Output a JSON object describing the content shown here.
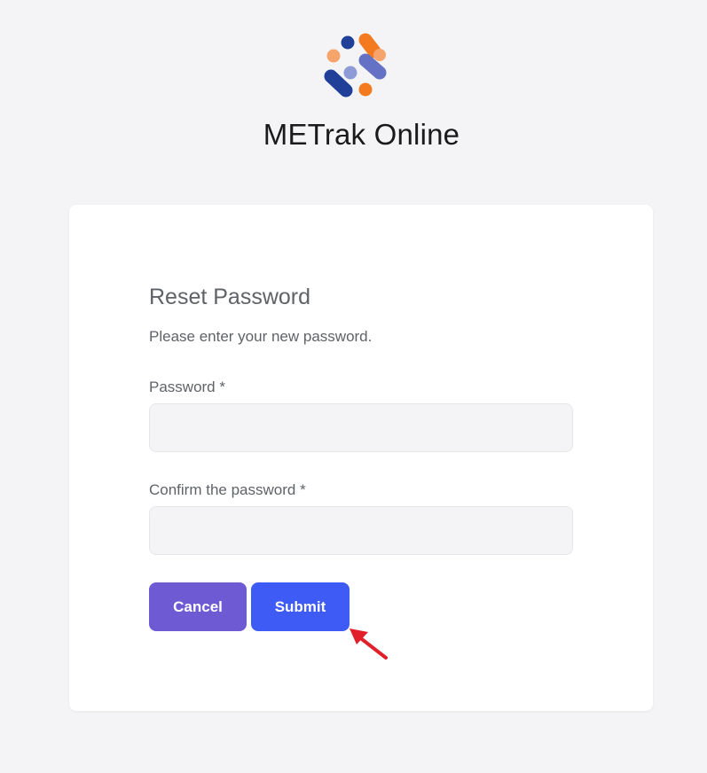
{
  "app": {
    "title": "METrak Online",
    "logo_icon": "dot-network-logo"
  },
  "form": {
    "title": "Reset Password",
    "subtitle": "Please enter your new password.",
    "password": {
      "label": "Password *",
      "value": "",
      "placeholder": ""
    },
    "confirm_password": {
      "label": "Confirm the password *",
      "value": "",
      "placeholder": ""
    },
    "cancel_label": "Cancel",
    "submit_label": "Submit"
  },
  "colors": {
    "page_background": "#f4f4f6",
    "card_background": "#ffffff",
    "cancel_button": "#6e5bd4",
    "submit_button": "#3f5bf6",
    "logo_navy": "#1f3f99",
    "logo_orange": "#f47a20",
    "logo_peach": "#f6a46b",
    "logo_lavender": "#6471c4",
    "annotation_arrow": "#e0202a"
  },
  "annotation": {
    "icon": "red-arrow-icon"
  }
}
